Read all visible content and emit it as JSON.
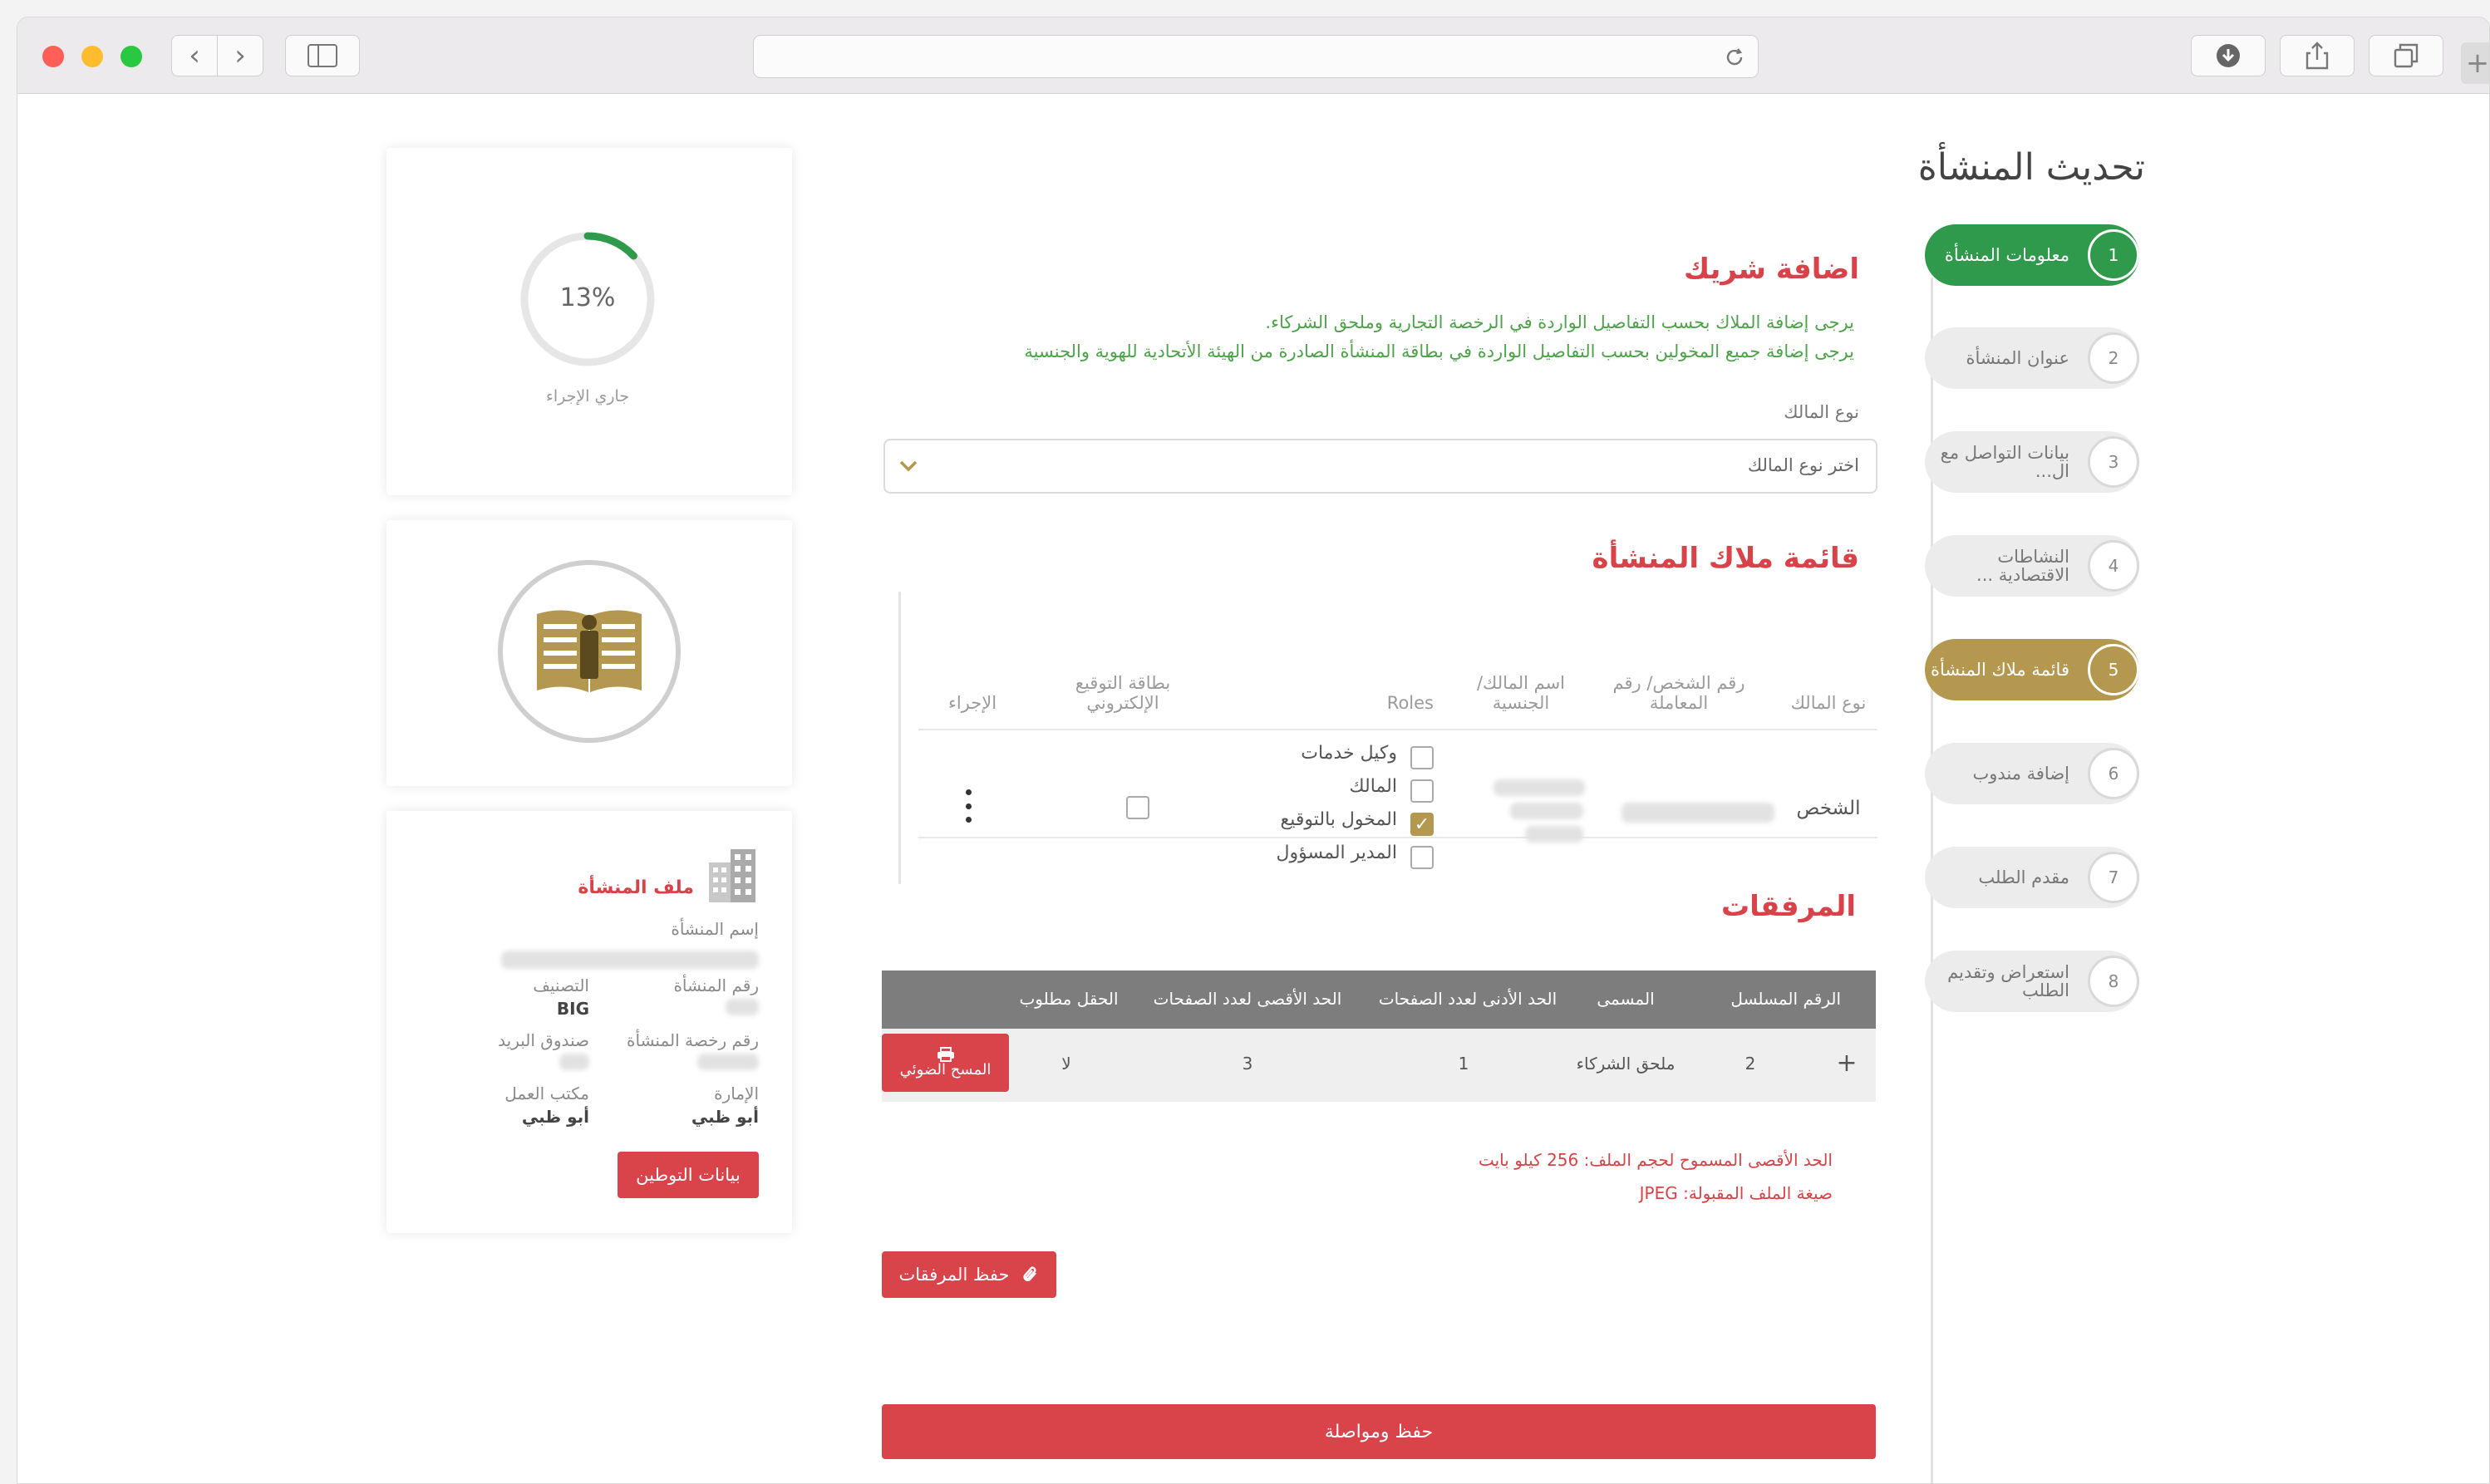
{
  "page": {
    "title": "تحديث المنشأة"
  },
  "steps": [
    {
      "num": "1",
      "label": "معلومات المنشأة",
      "state": "done"
    },
    {
      "num": "2",
      "label": "عنوان المنشأة",
      "state": "pending"
    },
    {
      "num": "3",
      "label": "بيانات التواصل مع ال...",
      "state": "pending"
    },
    {
      "num": "4",
      "label": "النشاطات الاقتصادية ...",
      "state": "pending"
    },
    {
      "num": "5",
      "label": "قائمة ملاك المنشأة",
      "state": "current"
    },
    {
      "num": "6",
      "label": "إضافة مندوب",
      "state": "pending"
    },
    {
      "num": "7",
      "label": "مقدم الطلب",
      "state": "pending"
    },
    {
      "num": "8",
      "label": "استعراض وتقديم الطلب",
      "state": "pending"
    }
  ],
  "add_partner": {
    "title": "اضافة شريك",
    "note_1": "يرجى إضافة الملاك بحسب التفاصيل الواردة في الرخصة التجارية وملحق الشركاء.",
    "note_2": "يرجى إضافة جميع المخولين بحسب التفاصيل الواردة في بطاقة المنشأة الصادرة من الهيئة الأتحادية للهوية والجنسية",
    "owner_type_label": "نوع المالك",
    "owner_type_placeholder": "اختر نوع المالك"
  },
  "owners": {
    "title": "قائمة ملاك المنشأة",
    "headers": {
      "owner_type": "نوع المالك",
      "person_no": "رقم الشخص/ رقم المعاملة",
      "owner_name": "اسم المالك/ الجنسية",
      "roles": "Roles",
      "esign": "بطاقة التوقيع الإلكتروني",
      "action": "الإجراء"
    },
    "row": {
      "owner_type": "الشخص",
      "roles": [
        {
          "label": "وكيل خدمات",
          "checked": false
        },
        {
          "label": "المالك",
          "checked": false
        },
        {
          "label": "المخول بالتوقيع",
          "checked": true
        },
        {
          "label": "المدير المسؤول",
          "checked": false
        }
      ],
      "action_icon": "more-vertical-icon"
    }
  },
  "attachments": {
    "title": "المرفقات",
    "headers": {
      "serial": "الرقم المسلسل",
      "name": "المسمى",
      "min_pages": "الحد الأدنى لعدد الصفحات",
      "max_pages": "الحد الأقصى لعدد الصفحات",
      "required": "الحقل مطلوب"
    },
    "row": {
      "expand": "+",
      "serial": "2",
      "name": "ملحق الشركاء",
      "min_pages": "1",
      "max_pages": "3",
      "required": "لا",
      "scan_button": "المسح الضوئي",
      "scan_icon": "printer-icon"
    },
    "max_size_note": "الحد الأقصى المسموح لحجم الملف: 256 كيلو بايت",
    "format_note": "صيغة الملف المقبولة: JPEG",
    "save_attachments": "حفظ المرفقات",
    "save_icon": "paperclip-icon"
  },
  "save_continue": "حفظ ومواصلة",
  "progress": {
    "percent": 13,
    "label": "13%",
    "status": "جاري الإجراء",
    "color": "#2f9a4b"
  },
  "guide": {
    "icon": "open-book-info-icon",
    "color": "#b59850"
  },
  "establishment": {
    "title": "ملف المنشأة",
    "icon": "building-icon",
    "name_label": "إسم المنشأة",
    "est_no_label": "رقم المنشأة",
    "class_label": "التصنيف",
    "class_value": "BIG",
    "license_label": "رقم رخصة المنشأة",
    "pobox_label": "صندوق البريد",
    "emirate_label": "الإمارة",
    "emirate_value": "أبو ظبي",
    "office_label": "مكتب العمل",
    "office_value": "أبو ظبي",
    "button": "بيانات التوطين"
  },
  "colors": {
    "red": "#d9434a",
    "green": "#2f9a4b",
    "gold": "#b59850",
    "table_header": "#7d7d7d"
  }
}
